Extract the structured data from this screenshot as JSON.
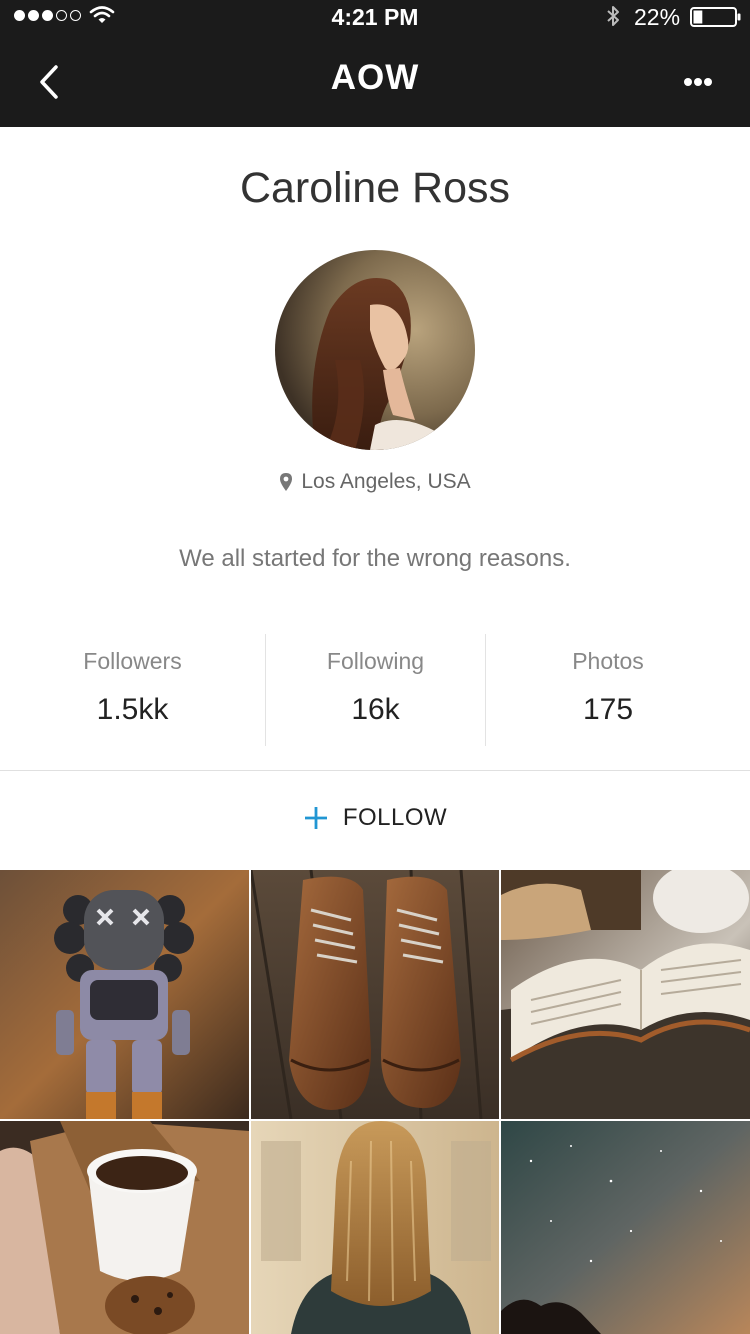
{
  "status_bar": {
    "time": "4:21 PM",
    "battery_percent": "22%",
    "signal": {
      "filled": 3,
      "total": 5
    },
    "battery_level": 0.22,
    "icons": [
      "wifi-icon",
      "bluetooth-icon",
      "battery-icon"
    ]
  },
  "nav": {
    "title": "AOW",
    "back_icon": "chevron-left-icon",
    "more_icon": "more-horizontal-icon"
  },
  "profile": {
    "name": "Caroline Ross",
    "location": "Los Angeles, USA",
    "bio": "We all started for the wrong reasons."
  },
  "stats": [
    {
      "label": "Followers",
      "value": "1.5kk"
    },
    {
      "label": "Following",
      "value": "16k"
    },
    {
      "label": "Photos",
      "value": "175"
    }
  ],
  "follow": {
    "label": "FOLLOW",
    "icon": "plus-icon",
    "icon_color": "#2196d3"
  },
  "photos": [
    {
      "subject": "toy-figure"
    },
    {
      "subject": "leather-shoes"
    },
    {
      "subject": "open-book"
    },
    {
      "subject": "coffee-cup"
    },
    {
      "subject": "blonde-hair"
    },
    {
      "subject": "night-sky"
    }
  ],
  "colors": {
    "header_bg": "#1b1b1b",
    "accent": "#2196d3",
    "divider": "#e0e0e0"
  }
}
